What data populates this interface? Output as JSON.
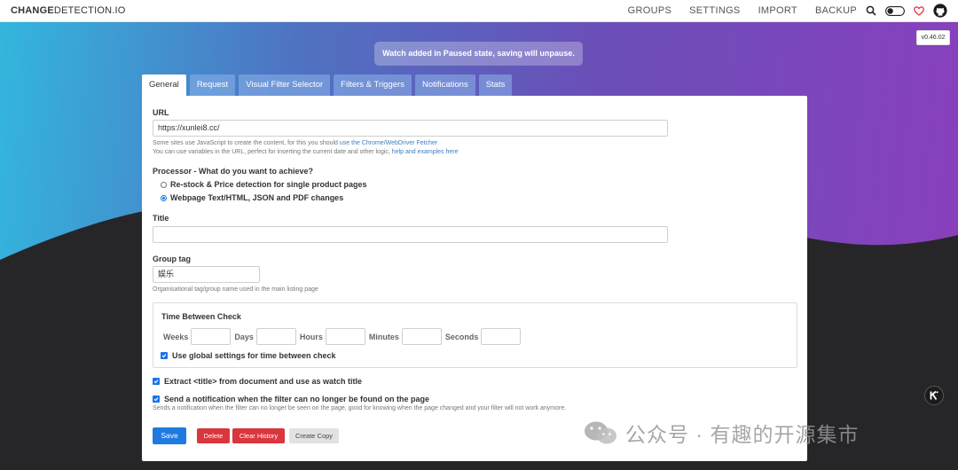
{
  "header": {
    "logo_bold": "CHANGE",
    "logo_rest": "DETECTION.IO",
    "nav": [
      "GROUPS",
      "SETTINGS",
      "IMPORT",
      "BACKUP"
    ]
  },
  "notice": "Watch added in Paused state, saving will unpause.",
  "version": "v0.46.02",
  "tabs": [
    "General",
    "Request",
    "Visual Filter Selector",
    "Filters & Triggers",
    "Notifications",
    "Stats"
  ],
  "form": {
    "url_label": "URL",
    "url_value": "https://xunlei8.cc/",
    "url_help1_pre": "Some sites use JavaScript to create the content, for this you should ",
    "url_help1_link": "use the Chrome/WebDriver Fetcher",
    "url_help2_pre": "You can use variables in the URL, perfect for inserting the current date and other logic, ",
    "url_help2_link": "help and examples here",
    "processor_label": "Processor - What do you want to achieve?",
    "processor_options": [
      "Re-stock & Price detection for single product pages",
      "Webpage Text/HTML, JSON and PDF changes"
    ],
    "title_label": "Title",
    "title_value": "",
    "group_label": "Group tag",
    "group_value": "娱乐",
    "group_help": "Organisational tag/group name used in the main listing page",
    "tbc_label": "Time Between Check",
    "tbc_units": [
      "Weeks",
      "Days",
      "Hours",
      "Minutes",
      "Seconds"
    ],
    "tbc_global": "Use global settings for time between check",
    "extract_title": "Extract <title> from document and use as watch title",
    "notify_filter": "Send a notification when the filter can no longer be found on the page",
    "notify_help": "Sends a notification when the filter can no longer be seen on the page, good for knowing when the page changed and your filter will not work anymore."
  },
  "buttons": {
    "save": "Save",
    "delete": "Delete",
    "clear_history": "Clear History",
    "create_copy": "Create Copy"
  },
  "watermark": "公众号 · 有趣的开源集市",
  "colors": {
    "primary": "#1f7ae0",
    "danger": "#d9363e",
    "gradient_left": "#33b6dd",
    "gradient_right": "#8a3fbc"
  }
}
